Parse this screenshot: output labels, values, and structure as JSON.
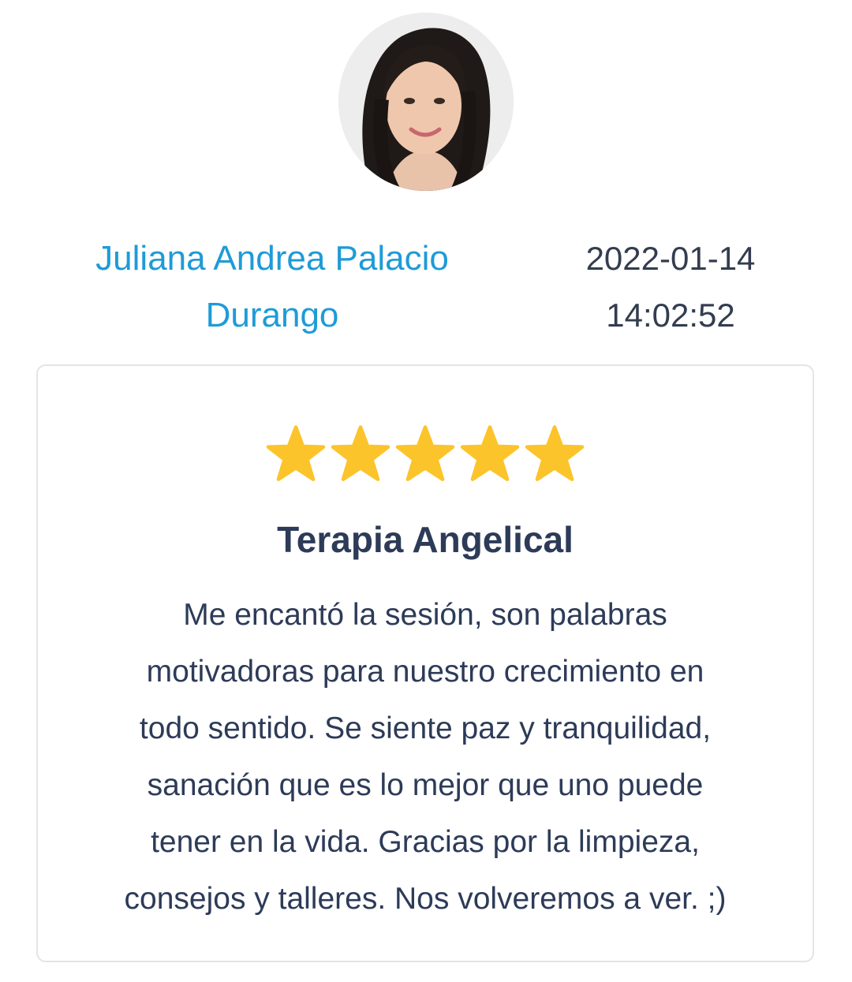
{
  "review": {
    "author_line1": "Juliana Andrea Palacio",
    "author_line2": "Durango",
    "date": "2022-01-14",
    "time": "14:02:52",
    "rating": 5,
    "rating_max": 5,
    "title": "Terapia Angelical",
    "body_lines": [
      "Me encantó la sesión, son palabras",
      "motivadoras para nuestro crecimiento en",
      "todo sentido. Se siente paz y tranquilidad,",
      "sanación que es lo mejor que uno puede",
      "tener en la vida. Gracias por la limpieza,",
      "consejos y talleres. Nos volveremos a ver. ;)"
    ]
  },
  "colors": {
    "author": "#1e9bd7",
    "text": "#2d3b58",
    "star": "#fcc42b",
    "card_border": "#e2e4e8"
  },
  "icons": {
    "star": "star-icon"
  }
}
